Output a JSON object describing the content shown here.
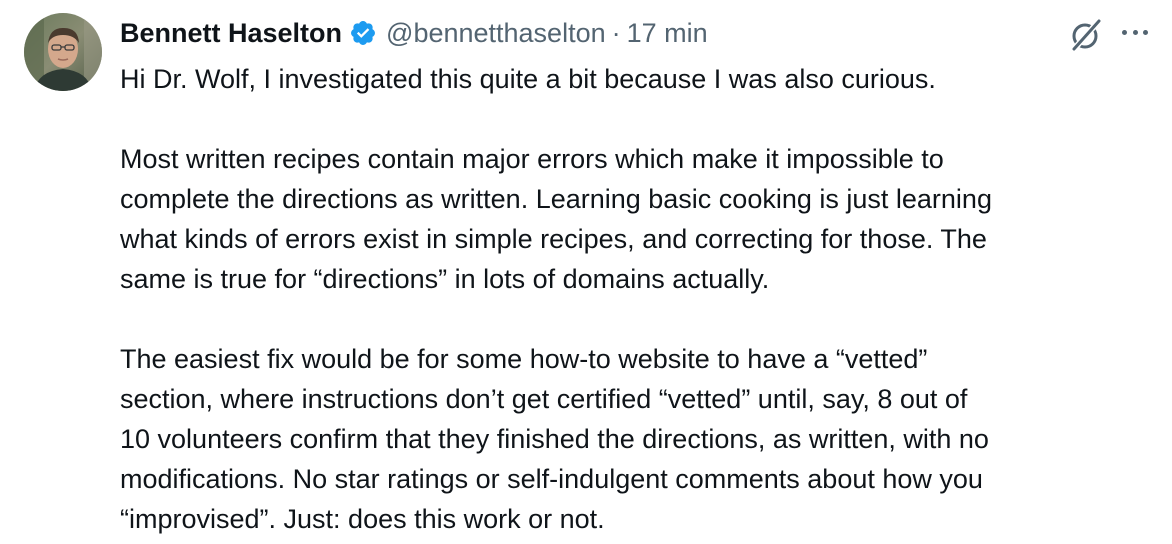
{
  "author": {
    "name": "Bennett Haselton",
    "handle": "@bennetthaselton",
    "separator": "·",
    "timestamp": "17 min"
  },
  "icons": {
    "avatar": "profile-photo",
    "verified": "verified-badge-icon",
    "grok": "grok-icon",
    "more": "more-options-icon"
  },
  "colors": {
    "verified_blue": "#1d9bf0",
    "secondary_text": "#536471",
    "primary_text": "#0f1419"
  },
  "tweet": {
    "paragraph_1": "Hi Dr. Wolf, I investigated this quite a bit because I was also curious.",
    "paragraph_2": "Most written recipes contain major errors which make it impossible to\ncomplete the directions as written. Learning basic cooking is just learning\nwhat kinds of errors exist in simple recipes, and correcting for those. The\nsame is true for “directions” in lots of domains actually.",
    "paragraph_3": "The easiest fix would be for some how-to website to have a “vetted”\nsection, where instructions don’t get certified “vetted” until, say, 8 out of\n10 volunteers confirm that they finished the directions, as written, with no\nmodifications. No star ratings or self-indulgent comments about how you\n“improvised”. Just: does this work or not."
  }
}
